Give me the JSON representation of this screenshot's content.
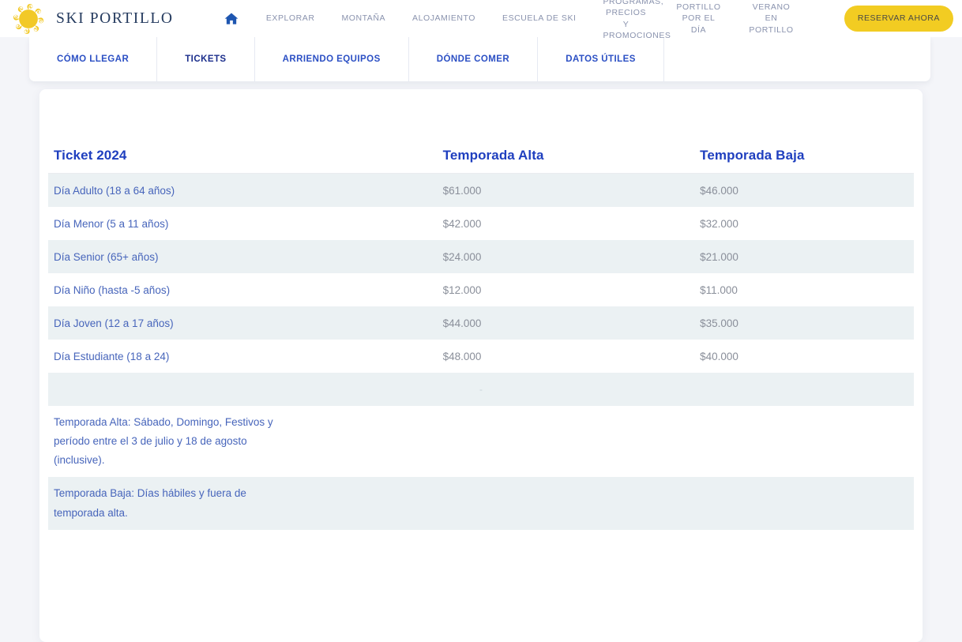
{
  "header": {
    "brand_name": "SKI PORTILLO",
    "logo_icon": "sun-logo-icon",
    "home_icon": "home-icon",
    "nav_items": [
      {
        "label": "EXPLORAR",
        "name": "nav-explorar",
        "multiline": false
      },
      {
        "label": "MONTAÑA",
        "name": "nav-montana",
        "multiline": false
      },
      {
        "label": "ALOJAMIENTO",
        "name": "nav-alojamiento",
        "multiline": false
      },
      {
        "label": "ESCUELA DE SKI",
        "name": "nav-escuela-de-ski",
        "multiline": false
      },
      {
        "label": "PROGRAMAS, PRECIOS Y PROMOCIONES",
        "name": "nav-programas-precios-promociones",
        "multiline": true
      },
      {
        "label": "PORTILLO POR EL DÍA",
        "name": "nav-portillo-por-el-dia",
        "multiline": true
      },
      {
        "label": "VERANO EN PORTILLO",
        "name": "nav-verano-en-portillo",
        "multiline": true
      }
    ],
    "reserve_button": "RESERVAR AHORA"
  },
  "subnav": {
    "items": [
      {
        "label": "CÓMO LLEGAR",
        "name": "subnav-como-llegar",
        "active": false
      },
      {
        "label": "TICKETS",
        "name": "subnav-tickets",
        "active": true
      },
      {
        "label": "ARRIENDO EQUIPOS",
        "name": "subnav-arriendo-equipos",
        "active": false
      },
      {
        "label": "DÓNDE COMER",
        "name": "subnav-donde-comer",
        "active": false
      },
      {
        "label": "DATOS ÚTILES",
        "name": "subnav-datos-utiles",
        "active": false
      }
    ]
  },
  "table": {
    "headers": {
      "name": "Ticket 2024",
      "alta": "Temporada Alta",
      "baja": "Temporada Baja"
    },
    "rows": [
      {
        "name": "Día Adulto (18 a 64 años)",
        "alta": "$61.000",
        "baja": "$46.000"
      },
      {
        "name": "Día Menor (5 a 11 años)",
        "alta": "$42.000",
        "baja": "$32.000"
      },
      {
        "name": "Día Senior (65+ años)",
        "alta": "$24.000",
        "baja": "$21.000"
      },
      {
        "name": "Día Niño (hasta -5 años)",
        "alta": "$12.000",
        "baja": "$11.000"
      },
      {
        "name": "Día Joven (12 a 17 años)",
        "alta": "$44.000",
        "baja": "$35.000"
      },
      {
        "name": "Día Estudiante (18 a 24)",
        "alta": "$48.000",
        "baja": "$40.000"
      }
    ],
    "spacer_text": "-",
    "notes": [
      "Temporada Alta: Sábado, Domingo, Festivos y período entre el 3 de julio y 18 de agosto (inclusive).",
      "Temporada Baja: Días hábiles y fuera de temporada alta."
    ]
  },
  "colors": {
    "brand_yellow": "#f2cc22",
    "link_blue": "#2b4fc4",
    "header_blue": "#1f3fbf",
    "row_stripe": "#ebf1f3",
    "page_bg": "#f4f5f9",
    "price_gray": "#8a8f9a"
  }
}
